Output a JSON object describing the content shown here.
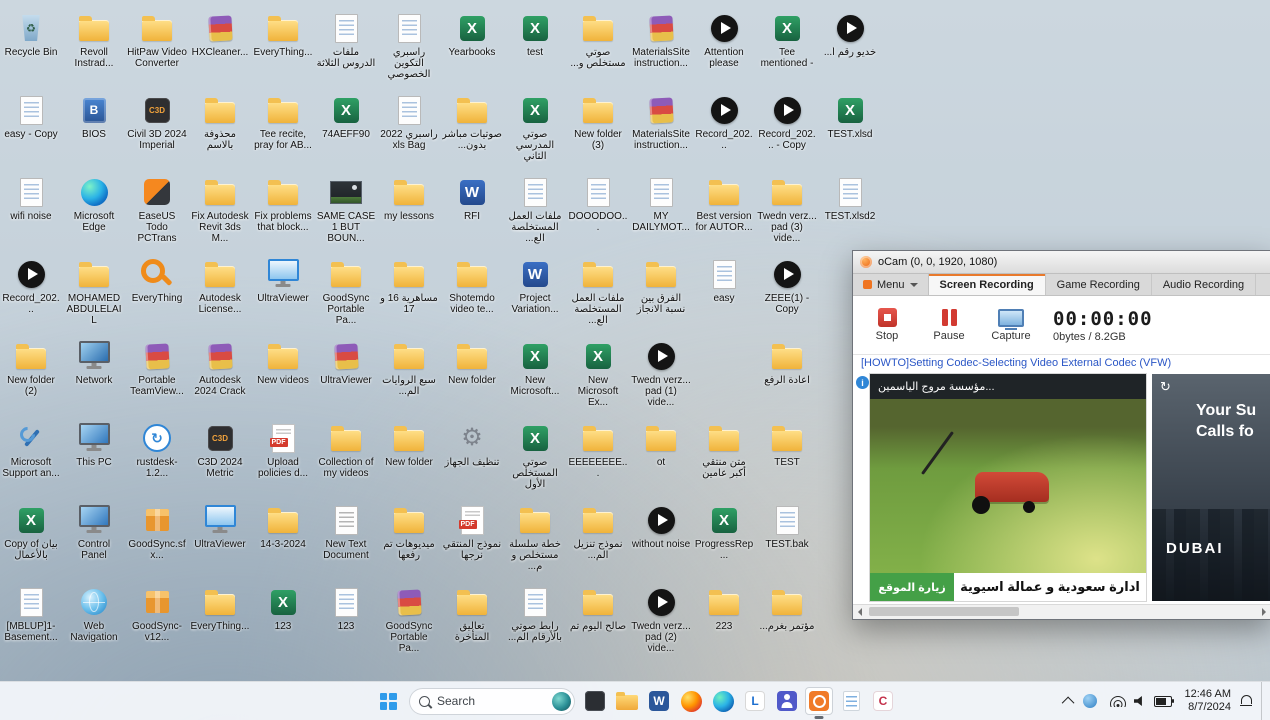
{
  "desktop": {
    "icons": [
      {
        "label": "Recycle Bin",
        "type": "recycle",
        "col": 0,
        "row": 0
      },
      {
        "label": "Revoll Instrad...",
        "type": "folder",
        "col": 1,
        "row": 0
      },
      {
        "label": "HitPaw Video Converter",
        "type": "folder",
        "col": 2,
        "row": 0
      },
      {
        "label": "HXCleaner...",
        "type": "winrar",
        "col": 3,
        "row": 0
      },
      {
        "label": "EveryThing...",
        "type": "folder",
        "col": 4,
        "row": 0
      },
      {
        "label": "ملفات الدروس الثلاثة",
        "type": "doc",
        "col": 5,
        "row": 0
      },
      {
        "label": "راسبري التكوين الخصوصي",
        "type": "doc",
        "col": 6,
        "row": 0
      },
      {
        "label": "Yearbooks",
        "type": "excel",
        "col": 7,
        "row": 0
      },
      {
        "label": "test",
        "type": "excel",
        "col": 8,
        "row": 0
      },
      {
        "label": "صوتي مستخلص و...",
        "type": "folder",
        "col": 9,
        "row": 0
      },
      {
        "label": "MaterialsSite instruction...",
        "type": "winrar",
        "col": 10,
        "row": 0
      },
      {
        "label": "Attention please",
        "type": "media",
        "col": 11,
        "row": 0
      },
      {
        "label": "Tee mentioned -",
        "type": "excel",
        "col": 12,
        "row": 0
      },
      {
        "label": "خديو رقم أ...",
        "type": "media",
        "col": 13,
        "row": 0
      },
      {
        "label": "easy - Copy",
        "type": "doc",
        "col": 0,
        "row": 1
      },
      {
        "label": "BIOS",
        "type": "bios",
        "col": 1,
        "row": 1
      },
      {
        "label": "Civil 3D 2024 Imperial",
        "type": "cad",
        "col": 2,
        "row": 1
      },
      {
        "label": "محذوفة بالاسم",
        "type": "folder",
        "col": 3,
        "row": 1
      },
      {
        "label": "Tee recite, pray for AB...",
        "type": "folder",
        "col": 4,
        "row": 1
      },
      {
        "label": "74AEFF90",
        "type": "excel",
        "col": 5,
        "row": 1
      },
      {
        "label": "راسبري 2022 xls Bag",
        "type": "doc",
        "col": 6,
        "row": 1
      },
      {
        "label": "صوتيات مباشر بدون...",
        "type": "folder",
        "col": 7,
        "row": 1
      },
      {
        "label": "صوتي المدرسي الثاني",
        "type": "excel",
        "col": 8,
        "row": 1
      },
      {
        "label": "New folder (3)",
        "type": "folder",
        "col": 9,
        "row": 1
      },
      {
        "label": "MaterialsSite instruction...",
        "type": "winrar",
        "col": 10,
        "row": 1
      },
      {
        "label": "Record_202...",
        "type": "media",
        "col": 11,
        "row": 1
      },
      {
        "label": "Record_202... - Copy",
        "type": "media",
        "col": 12,
        "row": 1
      },
      {
        "label": "TEST.xlsd",
        "type": "excel",
        "col": 13,
        "row": 1
      },
      {
        "label": "wifi noise",
        "type": "doc",
        "col": 0,
        "row": 2
      },
      {
        "label": "Microsoft Edge",
        "type": "edge",
        "col": 1,
        "row": 2
      },
      {
        "label": "EaseUS Todo PCTrans",
        "type": "easeus",
        "col": 2,
        "row": 2
      },
      {
        "label": "Fix Autodesk Revit 3ds M...",
        "type": "folder",
        "col": 3,
        "row": 2
      },
      {
        "label": "Fix problems that block...",
        "type": "folder",
        "col": 4,
        "row": 2
      },
      {
        "label": "SAME CASE 1 BUT BOUN...",
        "type": "image",
        "col": 5,
        "row": 2
      },
      {
        "label": "my lessons",
        "type": "folder",
        "col": 6,
        "row": 2
      },
      {
        "label": "RFI",
        "type": "word",
        "col": 7,
        "row": 2
      },
      {
        "label": "ملفات العمل المستخلصة الع...",
        "type": "doc",
        "col": 8,
        "row": 2
      },
      {
        "label": "DOOODOO...",
        "type": "doc",
        "col": 9,
        "row": 2
      },
      {
        "label": "MY DAILYMOT...",
        "type": "doc",
        "col": 10,
        "row": 2
      },
      {
        "label": "Best version for AUTOR...",
        "type": "folder",
        "col": 11,
        "row": 2
      },
      {
        "label": "Twedn verz... pad (3) vide...",
        "type": "folder",
        "col": 12,
        "row": 2
      },
      {
        "label": "TEST.xlsd2",
        "type": "doc",
        "col": 13,
        "row": 2
      },
      {
        "label": "Record_202...",
        "type": "media",
        "col": 0,
        "row": 3
      },
      {
        "label": "MOHAMED ABDULELAIL",
        "type": "folder",
        "col": 1,
        "row": 3
      },
      {
        "label": "EveryThing",
        "type": "magnifier",
        "col": 2,
        "row": 3
      },
      {
        "label": "Autodesk License...",
        "type": "folder",
        "col": 3,
        "row": 3
      },
      {
        "label": "UltraViewer",
        "type": "ultra",
        "col": 4,
        "row": 3
      },
      {
        "label": "GoodSync Portable Pa...",
        "type": "folder",
        "col": 5,
        "row": 3
      },
      {
        "label": "مساهرية 16 و 17",
        "type": "folder",
        "col": 6,
        "row": 3
      },
      {
        "label": "Shotemdo video te...",
        "type": "folder",
        "col": 7,
        "row": 3
      },
      {
        "label": "Project Variation...",
        "type": "word",
        "col": 8,
        "row": 3
      },
      {
        "label": "ملفات العمل المستخلصة الع...",
        "type": "folder",
        "col": 9,
        "row": 3
      },
      {
        "label": "الفرق بين نسبة الانجاز",
        "type": "folder",
        "col": 10,
        "row": 3
      },
      {
        "label": "easy",
        "type": "doc",
        "col": 11,
        "row": 3
      },
      {
        "label": "ZEEE(1) - Copy",
        "type": "media",
        "col": 12,
        "row": 3
      },
      {
        "label": "New folder (2)",
        "type": "folder",
        "col": 0,
        "row": 4
      },
      {
        "label": "Network",
        "type": "network",
        "col": 1,
        "row": 4
      },
      {
        "label": "Portable TeamView...",
        "type": "winrar",
        "col": 2,
        "row": 4
      },
      {
        "label": "Autodesk 2024 Crack",
        "type": "winrar",
        "col": 3,
        "row": 4
      },
      {
        "label": "New videos",
        "type": "folder",
        "col": 4,
        "row": 4
      },
      {
        "label": "UltraViewer",
        "type": "winrar",
        "col": 5,
        "row": 4
      },
      {
        "label": "سبع الروايات الم...",
        "type": "folder",
        "col": 6,
        "row": 4
      },
      {
        "label": "New folder",
        "type": "folder",
        "col": 7,
        "row": 4
      },
      {
        "label": "New Microsoft...",
        "type": "excel",
        "col": 8,
        "row": 4
      },
      {
        "label": "New Microsoft Ex...",
        "type": "excel",
        "col": 9,
        "row": 4
      },
      {
        "label": "Twedn verz... pad (1) vide...",
        "type": "media",
        "col": 10,
        "row": 4
      },
      {
        "label": "اعادة الرفع",
        "type": "folder",
        "col": 12,
        "row": 4
      },
      {
        "label": "Microsoft Support an...",
        "type": "tools",
        "col": 0,
        "row": 5
      },
      {
        "label": "This PC",
        "type": "pc",
        "col": 1,
        "row": 5
      },
      {
        "label": "rustdesk-1.2...",
        "type": "sync",
        "col": 2,
        "row": 5
      },
      {
        "label": "C3D 2024 Metric",
        "type": "cad",
        "col": 3,
        "row": 5
      },
      {
        "label": "Upload policies d...",
        "type": "pdf",
        "col": 4,
        "row": 5
      },
      {
        "label": "Collection of my videos",
        "type": "folder",
        "col": 5,
        "row": 5
      },
      {
        "label": "New folder",
        "type": "folder",
        "col": 6,
        "row": 5
      },
      {
        "label": "تنظيف الجهاز",
        "type": "gear",
        "col": 7,
        "row": 5
      },
      {
        "label": "صوتي المستخلص الأول",
        "type": "excel",
        "col": 8,
        "row": 5
      },
      {
        "label": "EEEEEEEE...",
        "type": "folder",
        "col": 9,
        "row": 5
      },
      {
        "label": "ot",
        "type": "folder",
        "col": 10,
        "row": 5
      },
      {
        "label": "متن منتقي أكبر عامين",
        "type": "folder",
        "col": 11,
        "row": 5
      },
      {
        "label": "TEST",
        "type": "folder",
        "col": 12,
        "row": 5
      },
      {
        "label": "Copy of بيان بالأعمال",
        "type": "excel",
        "col": 0,
        "row": 6
      },
      {
        "label": "Control Panel",
        "type": "pc",
        "col": 1,
        "row": 6
      },
      {
        "label": "GoodSync.sfx...",
        "type": "box",
        "col": 2,
        "row": 6
      },
      {
        "label": "UltraViewer",
        "type": "ultra",
        "col": 3,
        "row": 6
      },
      {
        "label": "14-3-2024",
        "type": "folder",
        "col": 4,
        "row": 6
      },
      {
        "label": "New Text Document",
        "type": "text",
        "col": 5,
        "row": 6
      },
      {
        "label": "ميديوهات تم رفعها",
        "type": "folder",
        "col": 6,
        "row": 6
      },
      {
        "label": "نموذج المنتقي نرجها",
        "type": "pdf",
        "col": 7,
        "row": 6
      },
      {
        "label": "خطة سلسلة مستخلص و م...",
        "type": "folder",
        "col": 8,
        "row": 6
      },
      {
        "label": "نموذج تنزيل الم...",
        "type": "folder",
        "col": 9,
        "row": 6
      },
      {
        "label": "without noise",
        "type": "media",
        "col": 10,
        "row": 6
      },
      {
        "label": "ProgressRep...",
        "type": "excel",
        "col": 11,
        "row": 6
      },
      {
        "label": "TEST.bak",
        "type": "doc",
        "col": 12,
        "row": 6
      },
      {
        "label": "[MBLUP]1- Basement...",
        "type": "doc",
        "col": 0,
        "row": 7
      },
      {
        "label": "Web Navigation",
        "type": "globe",
        "col": 1,
        "row": 7
      },
      {
        "label": "GoodSync-v12...",
        "type": "box",
        "col": 2,
        "row": 7
      },
      {
        "label": "EveryThing...",
        "type": "folder",
        "col": 3,
        "row": 7
      },
      {
        "label": "123",
        "type": "excel",
        "col": 4,
        "row": 7
      },
      {
        "label": "123",
        "type": "doc",
        "col": 5,
        "row": 7
      },
      {
        "label": "GoodSync Portable Pa...",
        "type": "winrar",
        "col": 6,
        "row": 7
      },
      {
        "label": "تعاليق المتأخرة",
        "type": "folder",
        "col": 7,
        "row": 7
      },
      {
        "label": "رابط صوتي بالأرقام الم...",
        "type": "doc",
        "col": 8,
        "row": 7
      },
      {
        "label": "صالح اليوم تم",
        "type": "folder",
        "col": 9,
        "row": 7
      },
      {
        "label": "Twedn verz... pad (2) vide...",
        "type": "media",
        "col": 10,
        "row": 7
      },
      {
        "label": "223",
        "type": "folder",
        "col": 11,
        "row": 7
      },
      {
        "label": "مؤتمر بغرم...",
        "type": "folder",
        "col": 12,
        "row": 7
      }
    ]
  },
  "ocam": {
    "title": "oCam (0, 0, 1920, 1080)",
    "menu_label": "Menu",
    "tabs": [
      {
        "label": "Screen Recording",
        "active": true
      },
      {
        "label": "Game Recording",
        "active": false
      },
      {
        "label": "Audio Recording",
        "active": false
      }
    ],
    "controls": [
      {
        "label": "Stop"
      },
      {
        "label": "Pause"
      },
      {
        "label": "Capture"
      }
    ],
    "timer": "00:00:00",
    "size_info": "0bytes / 8.2GB",
    "howto_link": "[HOWTO]Setting Codec-Selecting Video External Codec (VFW)",
    "preview": {
      "ad_top_text": "...مؤسسة مروج الياسمين",
      "ad_bottom_text": "ادارة سعودية و عمالة اسيوية",
      "ad_button": "زيارة الموقع",
      "side_ad_line1": "Your Su",
      "side_ad_line2": "Calls fo",
      "side_ad_brand": "DUBAI",
      "refresh_glyph": "↻"
    },
    "accent_green": "#44a047",
    "link_color": "#2a56c6"
  },
  "taskbar": {
    "search_label": "Search",
    "icons": [
      {
        "name": "app-dark-icon",
        "type": "dark"
      },
      {
        "name": "file-explorer-icon",
        "type": "explorer"
      },
      {
        "name": "word-icon",
        "type": "wordapp"
      },
      {
        "name": "firefox-icon",
        "type": "firefox"
      },
      {
        "name": "edge-icon",
        "type": "edgeapp"
      },
      {
        "name": "app-l-icon",
        "type": "lapp"
      },
      {
        "name": "teams-icon",
        "type": "teams"
      },
      {
        "name": "ocam-icon",
        "type": "ocamapp",
        "active": true
      },
      {
        "name": "notepad-icon",
        "type": "notes"
      },
      {
        "name": "clipchamp-icon",
        "type": "clip"
      }
    ],
    "tray": {
      "time": "12:46 AM",
      "date": "8/7/2024"
    }
  }
}
